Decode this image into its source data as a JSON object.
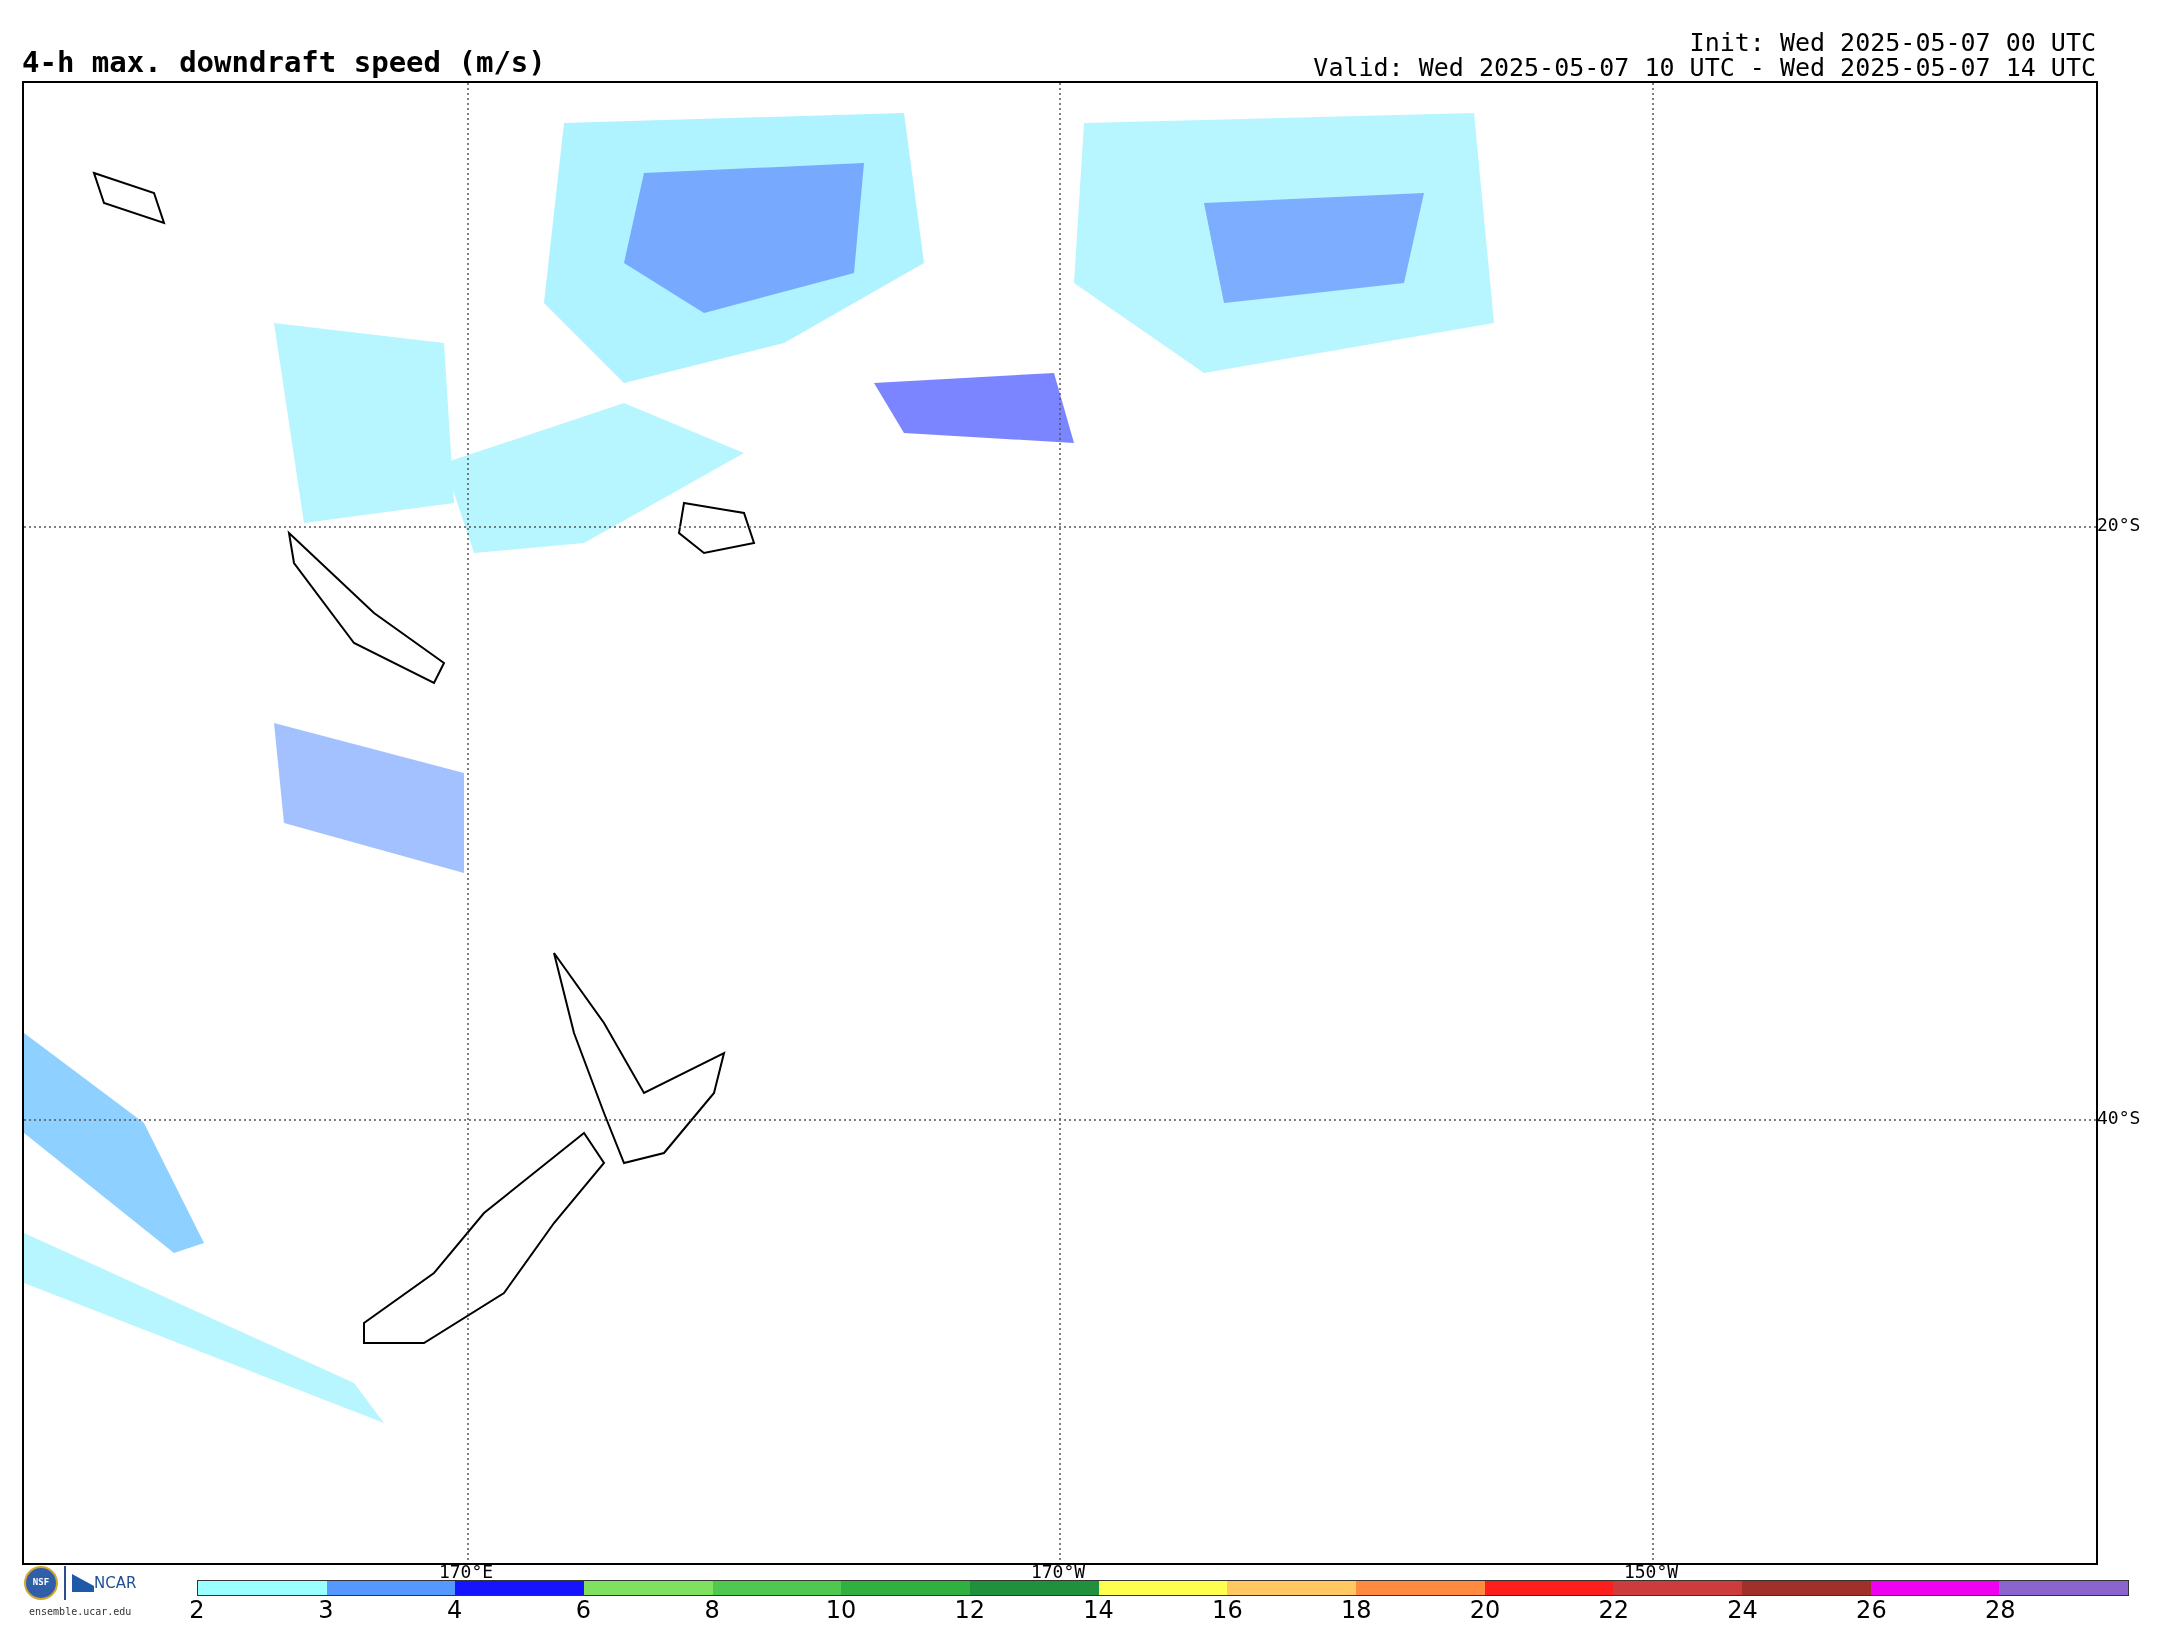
{
  "title": "4-h max. downdraft speed (m/s)",
  "init": "Init: Wed 2025-05-07 00 UTC",
  "valid": "Valid: Wed 2025-05-07 10 UTC - Wed 2025-05-07 14 UTC",
  "map": {
    "lon_labels": [
      "170°E",
      "170°W",
      "150°W"
    ],
    "lat_labels": [
      "20°S",
      "40°S"
    ]
  },
  "logos": {
    "nsf": "NSF",
    "ncar": "NCAR",
    "url": "ensemble.ucar.edu"
  },
  "colorbar": {
    "ticks": [
      "2",
      "3",
      "4",
      "6",
      "8",
      "10",
      "12",
      "14",
      "16",
      "18",
      "20",
      "22",
      "24",
      "26",
      "28"
    ],
    "bins": [
      {
        "color": "#99ffff"
      },
      {
        "color": "#5599ff"
      },
      {
        "color": "#1414ff"
      },
      {
        "color": "#80e060"
      },
      {
        "color": "#50c850"
      },
      {
        "color": "#30b040"
      },
      {
        "color": "#20903c"
      },
      {
        "color": "#ffff50"
      },
      {
        "color": "#ffc860"
      },
      {
        "color": "#ff8a40"
      },
      {
        "color": "#ff1e1e"
      },
      {
        "color": "#cc3c3c"
      },
      {
        "color": "#a0302a"
      },
      {
        "color": "#f000f0"
      },
      {
        "color": "#8c64d0"
      }
    ]
  }
}
